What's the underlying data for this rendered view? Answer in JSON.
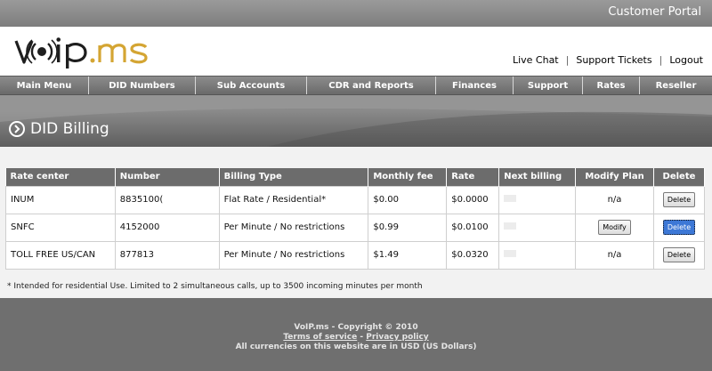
{
  "header": {
    "portal_title": "Customer Portal",
    "links": [
      {
        "label": "Live Chat"
      },
      {
        "label": "Support Tickets"
      },
      {
        "label": "Logout"
      }
    ]
  },
  "nav": {
    "items": [
      {
        "label": "Main Menu"
      },
      {
        "label": "DID Numbers"
      },
      {
        "label": "Sub Accounts"
      },
      {
        "label": "CDR and Reports"
      },
      {
        "label": "Finances"
      },
      {
        "label": "Support"
      },
      {
        "label": "Rates"
      },
      {
        "label": "Reseller"
      }
    ]
  },
  "page": {
    "title": "DID Billing"
  },
  "table": {
    "columns": [
      "Rate center",
      "Number",
      "Billing Type",
      "Monthly fee",
      "Rate",
      "Next billing",
      "Modify Plan",
      "Delete"
    ],
    "rows": [
      {
        "rate_center": "INUM",
        "number": "8835100(",
        "billing_type": "Flat Rate / Residential*",
        "monthly_fee": "$0.00",
        "rate": "$0.0000",
        "modify": "n/a",
        "delete": "Delete"
      },
      {
        "rate_center": "SNFC",
        "number": "4152000",
        "billing_type": "Per Minute / No restrictions",
        "monthly_fee": "$0.99",
        "rate": "$0.0100",
        "modify": "Modify",
        "delete": "Delete"
      },
      {
        "rate_center": "TOLL FREE US/CAN",
        "number": "877813",
        "billing_type": "Per Minute / No restrictions",
        "monthly_fee": "$1.49",
        "rate": "$0.0320",
        "modify": "n/a",
        "delete": "Delete"
      }
    ],
    "footnote": "* Intended for residential Use. Limited to 2 simultaneous calls, up to 3500 incoming minutes per month"
  },
  "footer": {
    "copyright": "VoIP.ms - Copyright © 2010",
    "terms": "Terms of service",
    "separator": "-",
    "privacy": "Privacy policy",
    "currency_note": "All currencies on this website are in USD (US Dollars)"
  },
  "colors": {
    "logo_dark": "#1e1e1e",
    "logo_accent": "#d4a533",
    "nav_bg": "#7a7a7a",
    "selected_button": "#3d78d6"
  }
}
